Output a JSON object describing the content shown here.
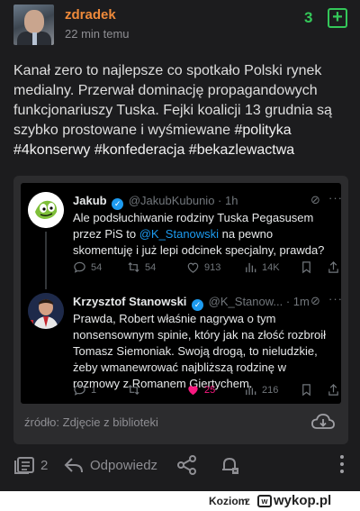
{
  "post": {
    "username": "zdradek",
    "time": "22 min temu",
    "votes": "3",
    "plus_symbol": "+",
    "body_text": "Kanał zero to najlepsze co spotkało Polski rynek medialny. Przerwał dominację propagandowych funkcjonariuszy Tuska. Fejki koalicji 13 grudnia są szybko prostowane i wyśmiewane ",
    "tags": [
      "#polityka",
      "#4konserwy",
      "#konfederacja",
      "#bekazlewactwa"
    ]
  },
  "embed": {
    "tweets": [
      {
        "name": "Jakub",
        "handle": "@JakubKubunio · 1h",
        "text_before": "Ale podsłuchiwanie rodziny Tuska Pegasusem przez PiS to ",
        "mention": "@K_Stanowski",
        "text_after": " na pewno skomentuję i już lepi odcinek specjalny, prawda?",
        "replies": "54",
        "retweets": "54",
        "likes": "913",
        "views": "14K"
      },
      {
        "name": "Krzysztof Stanowski",
        "handle": "@K_Stanow... · 1m",
        "text": "Prawda, Robert właśnie nagrywa o tym nonsensownym spinie, który jak na złość rozbroił Tomasz Siemoniak. Swoją drogą, to nieludzkie, żeby wmanewrować najbliższą rodzinę w rozmowy z Romanem Giertychem.",
        "replies": "1",
        "retweets": "",
        "likes": "25",
        "views": "216"
      }
    ],
    "source_label": "źródło: Zdjęcie z biblioteki"
  },
  "footer": {
    "comments_count": "2",
    "reply_label": "Odpowiedz"
  },
  "watermark": {
    "user": "Koziom",
    "z": "z",
    "site": "wykop.pl"
  },
  "colors": {
    "username": "#ef8a3a",
    "votes": "#34c759",
    "mention": "#1d9bf0",
    "like": "#f91880"
  }
}
